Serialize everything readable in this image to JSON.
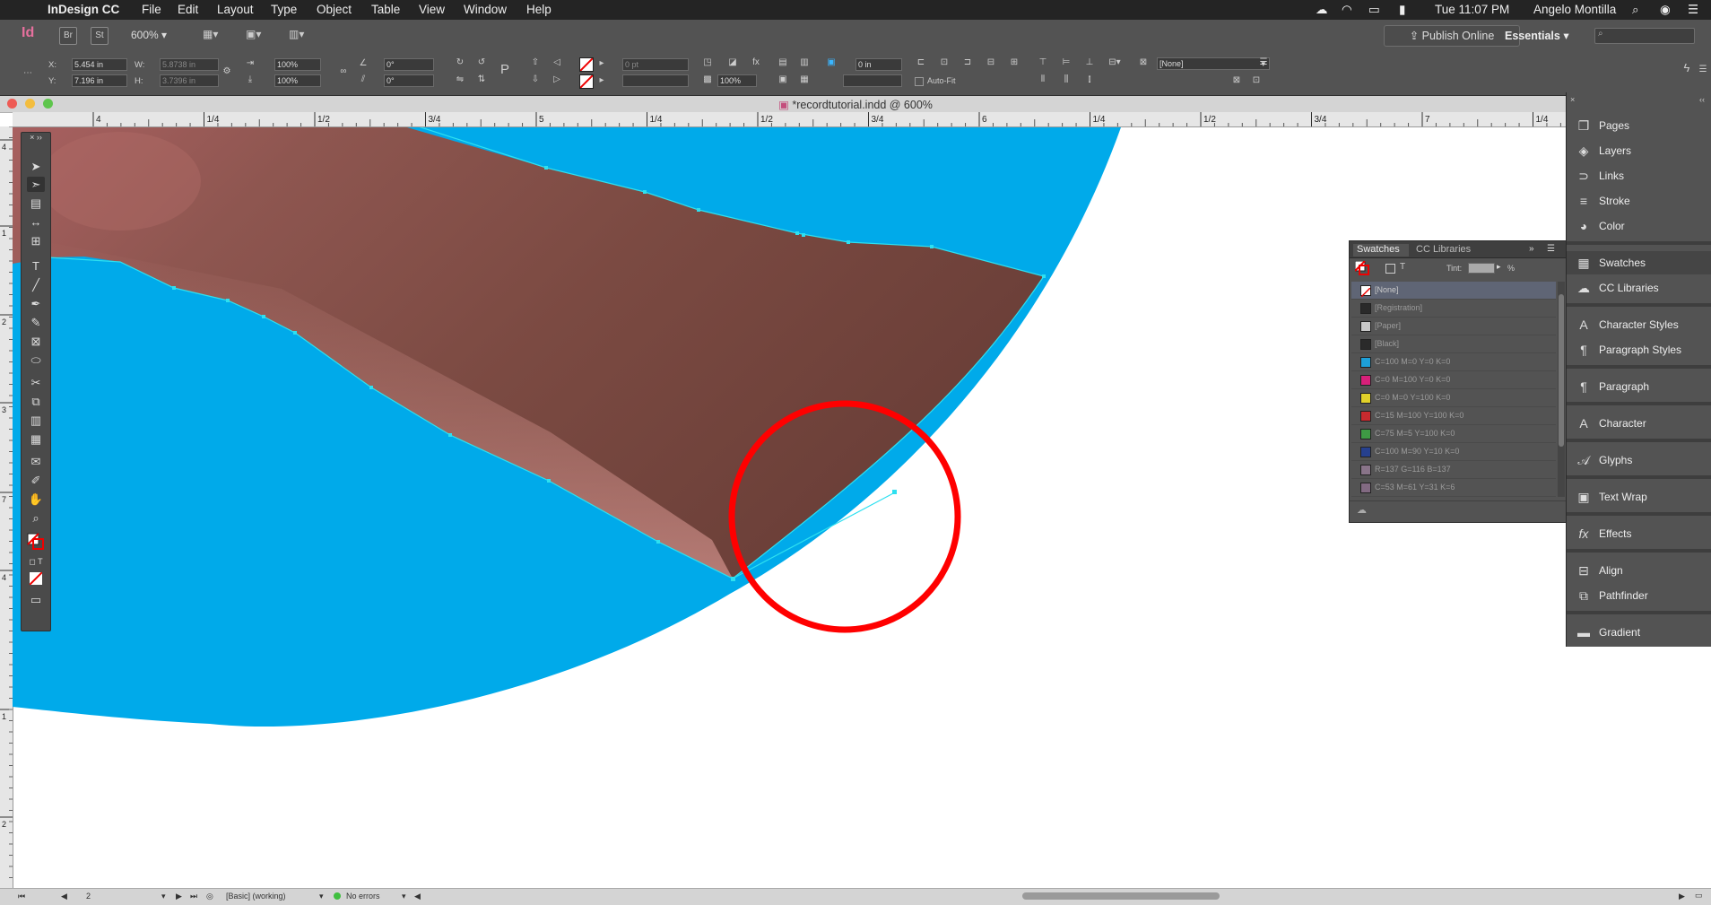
{
  "menubar": {
    "app_name": "InDesign CC",
    "menus": [
      "File",
      "Edit",
      "Layout",
      "Type",
      "Object",
      "Table",
      "View",
      "Window",
      "Help"
    ],
    "clock": "Tue 11:07 PM",
    "user": "Angelo Montilla",
    "icons": [
      "apple-icon",
      "creative-cloud-icon",
      "wifi-icon",
      "airplay-icon",
      "battery-icon",
      "search-icon",
      "siri-icon",
      "notification-center-icon"
    ]
  },
  "appbar": {
    "logo": "Id",
    "bridge": "Br",
    "stock": "St",
    "zoom": "600%",
    "publish_label": "Publish Online",
    "workspace": "Essentials"
  },
  "control": {
    "x_label": "X:",
    "x_value": "5.454 in",
    "y_label": "Y:",
    "y_value": "7.196 in",
    "w_label": "W:",
    "w_value": "5.8738 in",
    "h_label": "H:",
    "h_value": "3.7396 in",
    "scale_x": "100%",
    "scale_y": "100%",
    "rotate": "0°",
    "shear": "0°",
    "stroke_weight": "0 pt",
    "offset": "0 in",
    "opacity": "100%",
    "auto_fit": "Auto-Fit",
    "object_style": "[None]"
  },
  "document": {
    "title": "*recordtutorial.indd @ 600%",
    "ruler_h": [
      "4",
      "1/4",
      "1/2",
      "3/4",
      "5",
      "1/4",
      "1/2",
      "3/4",
      "6",
      "1/4",
      "1/2",
      "3/4",
      "7",
      "1/4"
    ],
    "ruler_v": [
      "4",
      "1",
      "2",
      "3",
      "7",
      "4",
      "1",
      "2"
    ]
  },
  "swatches": {
    "tab_active": "Swatches",
    "tab_other": "CC Libraries",
    "tint_label": "Tint:",
    "tint_unit": "%",
    "items": [
      {
        "name": "[None]",
        "color": "#ffffff"
      },
      {
        "name": "[Registration]",
        "color": "#2a2a2a"
      },
      {
        "name": "[Paper]",
        "color": "#c8c8c8"
      },
      {
        "name": "[Black]",
        "color": "#2a2a2a"
      },
      {
        "name": "C=100 M=0 Y=0 K=0",
        "color": "#1ea0d8"
      },
      {
        "name": "C=0 M=100 Y=0 K=0",
        "color": "#d8207a"
      },
      {
        "name": "C=0 M=0 Y=100 K=0",
        "color": "#e2d22a"
      },
      {
        "name": "C=15 M=100 Y=100 K=0",
        "color": "#c82a2e"
      },
      {
        "name": "C=75 M=5 Y=100 K=0",
        "color": "#3e9a44"
      },
      {
        "name": "C=100 M=90 Y=10 K=0",
        "color": "#26408e"
      },
      {
        "name": "R=137 G=116 B=137",
        "color": "#897489"
      },
      {
        "name": "C=53 M=61 Y=31 K=6",
        "color": "#826a82"
      }
    ]
  },
  "dock": {
    "items": [
      {
        "label": "Pages",
        "icon": "pages-icon",
        "glyph": "❐"
      },
      {
        "label": "Layers",
        "icon": "layers-icon",
        "glyph": "◈"
      },
      {
        "label": "Links",
        "icon": "links-icon",
        "glyph": "⊃"
      },
      {
        "label": "Stroke",
        "icon": "stroke-icon",
        "glyph": "≡"
      },
      {
        "label": "Color",
        "icon": "color-icon",
        "glyph": "◕"
      },
      {
        "label": "Swatches",
        "icon": "swatches-icon",
        "glyph": "▦"
      },
      {
        "label": "CC Libraries",
        "icon": "cc-libraries-icon",
        "glyph": "☁"
      },
      {
        "label": "Character Styles",
        "icon": "character-styles-icon",
        "glyph": "A"
      },
      {
        "label": "Paragraph Styles",
        "icon": "paragraph-styles-icon",
        "glyph": "¶"
      },
      {
        "label": "Paragraph",
        "icon": "paragraph-icon",
        "glyph": "¶"
      },
      {
        "label": "Character",
        "icon": "character-icon",
        "glyph": "A"
      },
      {
        "label": "Glyphs",
        "icon": "glyphs-icon",
        "glyph": "𝒜"
      },
      {
        "label": "Text Wrap",
        "icon": "text-wrap-icon",
        "glyph": "▣"
      },
      {
        "label": "Effects",
        "icon": "effects-icon",
        "glyph": "fx"
      },
      {
        "label": "Align",
        "icon": "align-icon",
        "glyph": "⊟"
      },
      {
        "label": "Pathfinder",
        "icon": "pathfinder-icon",
        "glyph": "⧉"
      },
      {
        "label": "Gradient",
        "icon": "gradient-icon",
        "glyph": "▬"
      }
    ]
  },
  "status": {
    "page": "2",
    "preflight_profile": "[Basic] (working)",
    "errors": "No errors"
  },
  "colors": {
    "blue_shape": "#00aaea",
    "skin_dark": "#7a4a40",
    "highlight_circle": "#ff0000",
    "selection": "#00e5ff"
  }
}
